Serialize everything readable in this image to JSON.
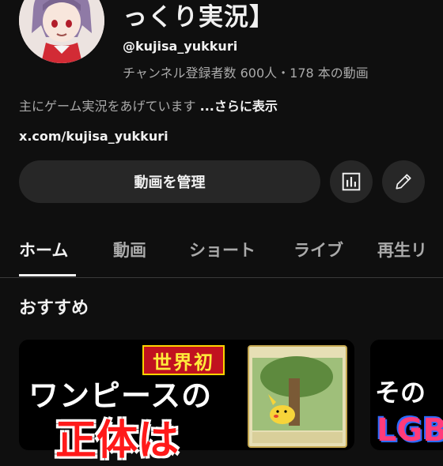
{
  "channel": {
    "title": "っくり実況】",
    "handle": "@kujisa_yukkuri",
    "subscribers": "チャンネル登録者数 600人",
    "separator": "・",
    "video_count": "178 本の動画",
    "description": "主にゲーム実況をあげています",
    "more_label": "...さらに表示",
    "link": "x.com/kujisa_yukkuri"
  },
  "actions": {
    "manage_label": "動画を管理",
    "analytics_icon": "analytics-icon",
    "edit_icon": "pencil-icon"
  },
  "tabs": [
    {
      "label": "ホーム",
      "active": true
    },
    {
      "label": "動画",
      "active": false
    },
    {
      "label": "ショート",
      "active": false
    },
    {
      "label": "ライブ",
      "active": false
    },
    {
      "label": "再生リ",
      "active": false
    }
  ],
  "section": {
    "title": "おすすめ"
  },
  "thumbnails": [
    {
      "badge": "世界初",
      "headline": "ワンピースの",
      "subline": "正体は"
    },
    {
      "headline": "その",
      "subline": "LGB"
    }
  ],
  "colors": {
    "background": "#0f0f0f",
    "button": "#272727",
    "text_primary": "#f1f1f1",
    "text_secondary": "#aaaaaa"
  }
}
